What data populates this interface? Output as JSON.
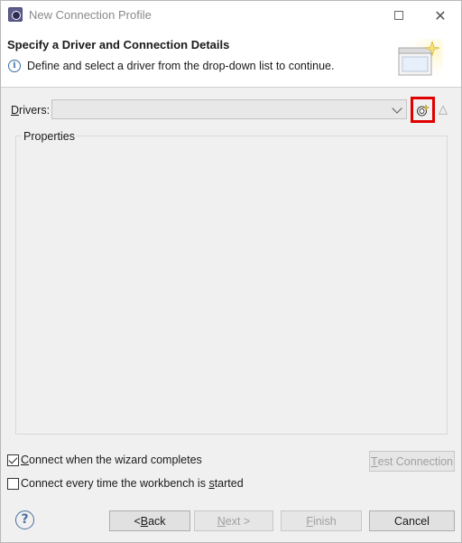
{
  "window": {
    "title": "New Connection Profile"
  },
  "banner": {
    "title": "Specify a Driver and Connection Details",
    "description": "Define and select a driver from the drop-down list to continue."
  },
  "drivers": {
    "label_prefix": "D",
    "label_rest": "rivers:",
    "selected_value": ""
  },
  "properties": {
    "group_label": "Properties"
  },
  "options": {
    "connect_on_complete_prefix": "C",
    "connect_on_complete_rest": "onnect when the wizard completes",
    "connect_on_complete_checked": true,
    "connect_on_start_prefix": "Connect every time the workbench is ",
    "connect_on_start_hotkey": "s",
    "connect_on_start_rest": "tarted",
    "connect_on_start_checked": false
  },
  "buttons": {
    "test_connection_prefix": "",
    "test_connection_hotkey": "T",
    "test_connection_rest": "est Connection",
    "back_prefix": "< ",
    "back_hotkey": "B",
    "back_rest": "ack",
    "next_hotkey": "N",
    "next_rest": "ext >",
    "finish_hotkey": "F",
    "finish_rest": "inish",
    "cancel": "Cancel"
  },
  "icons": {
    "app": "eclipse-app-icon",
    "info": "info-icon",
    "wizard": "wizard-banner-graphic",
    "new_driver": "new-driver-definition-icon",
    "edit_driver": "edit-driver-definition-icon",
    "help": "help-icon"
  },
  "colors": {
    "highlight_border": "#e00000"
  }
}
